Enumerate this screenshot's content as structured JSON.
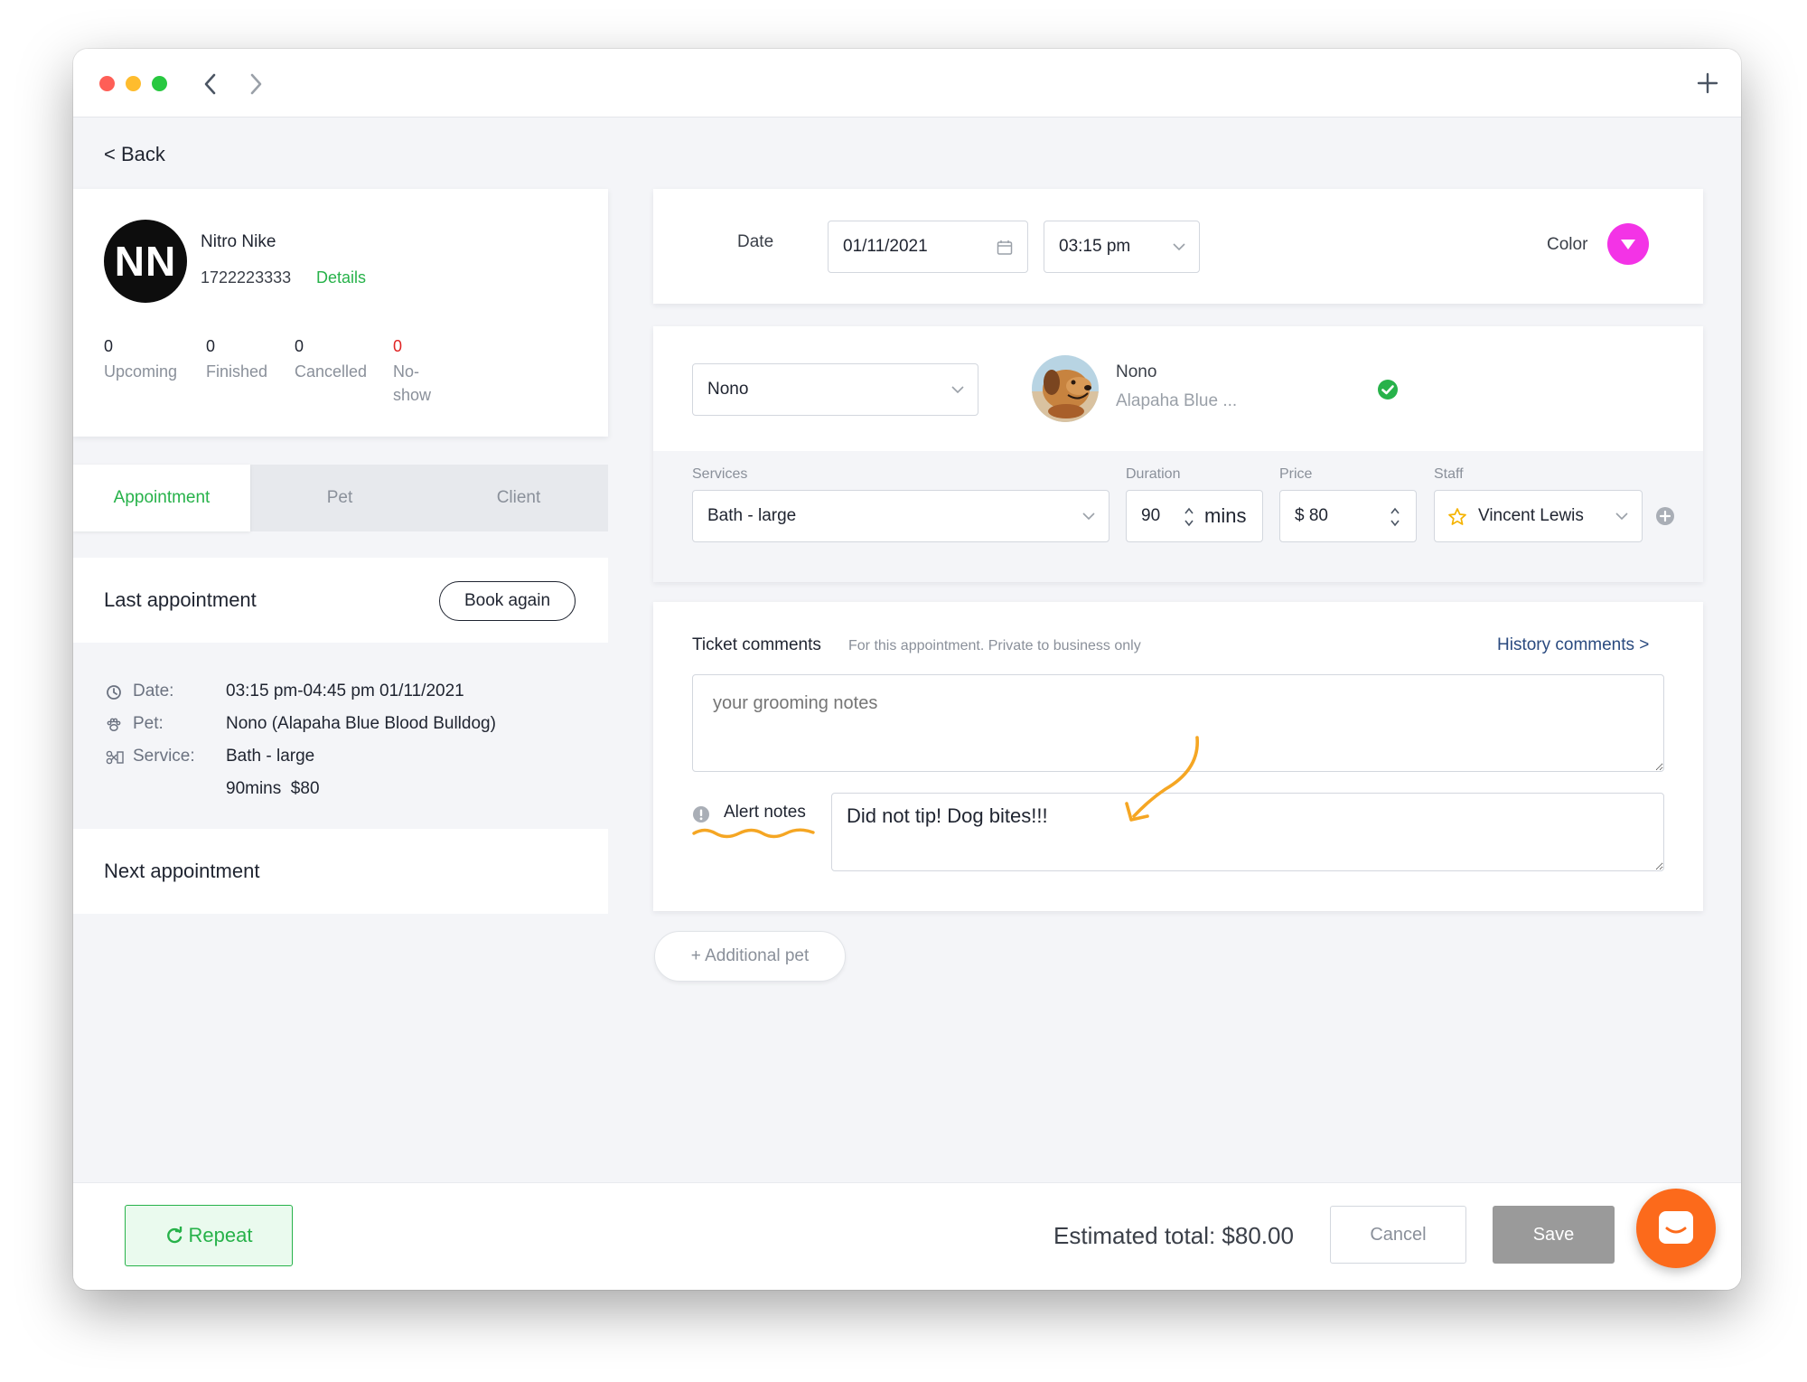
{
  "nav": {
    "back_label": "< Back"
  },
  "client": {
    "initials": "NN",
    "name": "Nitro Nike",
    "phone": "1722223333",
    "details_link": "Details",
    "stats": [
      {
        "value": "0",
        "label": "Upcoming"
      },
      {
        "value": "0",
        "label": "Finished"
      },
      {
        "value": "0",
        "label": "Cancelled"
      },
      {
        "value": "0",
        "label_line1": "No-",
        "label_line2": "show"
      }
    ]
  },
  "tabs": {
    "appointment": "Appointment",
    "pet": "Pet",
    "client": "Client",
    "active": "Appointment"
  },
  "last_appointment": {
    "title": "Last appointment",
    "book_again": "Book again",
    "date_label": "Date:",
    "date_value": "03:15 pm-04:45 pm 01/11/2021",
    "pet_label": "Pet:",
    "pet_value": "Nono (Alapaha Blue Blood Bulldog)",
    "service_label": "Service:",
    "service_value": "Bath - large",
    "service_detail": "90mins  $80"
  },
  "next_appointment": {
    "title": "Next appointment"
  },
  "schedule": {
    "date_label": "Date",
    "date_value": "01/11/2021",
    "time_value": "03:15 pm",
    "color_label": "Color",
    "color_value": "#f333e6"
  },
  "pet": {
    "select_value": "Nono",
    "name": "Nono",
    "breed": "Alapaha Blue ..."
  },
  "service": {
    "services_label": "Services",
    "services_value": "Bath - large",
    "duration_label": "Duration",
    "duration_value": "90",
    "duration_unit": "mins",
    "price_label": "Price",
    "price_value": "$ 80",
    "staff_label": "Staff",
    "staff_value": "Vincent Lewis"
  },
  "comments": {
    "ticket_label": "Ticket comments",
    "ticket_hint": "For this appointment. Private to business only",
    "history_link": "History comments >",
    "notes_placeholder": "your grooming notes",
    "alert_label": "Alert notes",
    "alert_value": "Did not tip! Dog bites!!!"
  },
  "additional_pet": "+ Additional pet",
  "footer": {
    "repeat_label": "Repeat",
    "estimated_total": "Estimated total: $80.00",
    "cancel_label": "Cancel",
    "save_label": "Save"
  },
  "colors": {
    "accent_green": "#27b24a",
    "alert_orange": "#f5a623",
    "chat_orange": "#fc6a1b",
    "history_blue": "#2a4a7f"
  }
}
